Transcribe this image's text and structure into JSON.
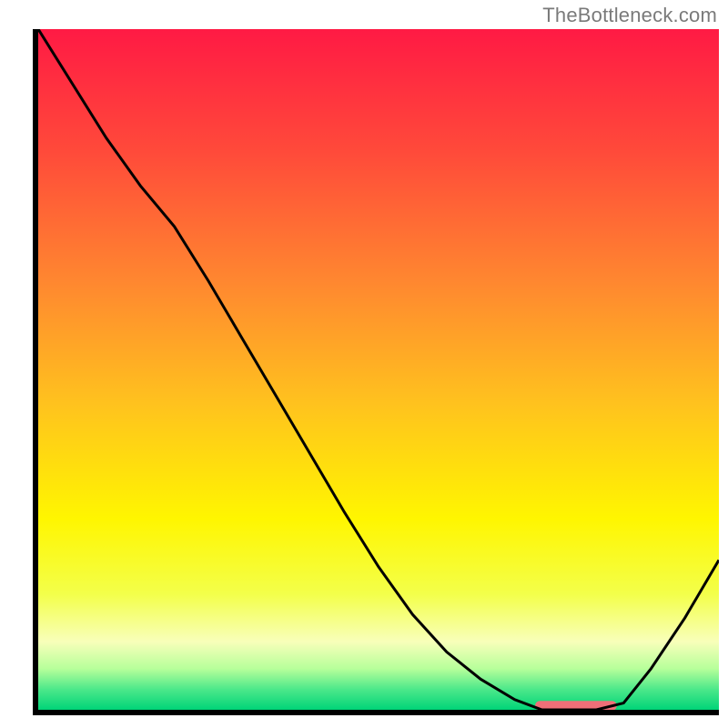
{
  "attribution": "TheBottleneck.com",
  "chart_data": {
    "type": "line",
    "x": [
      0.0,
      0.05,
      0.1,
      0.15,
      0.2,
      0.25,
      0.3,
      0.35,
      0.4,
      0.45,
      0.5,
      0.55,
      0.6,
      0.65,
      0.7,
      0.74,
      0.78,
      0.82,
      0.86,
      0.9,
      0.95,
      1.0
    ],
    "values": [
      1.0,
      0.92,
      0.84,
      0.77,
      0.71,
      0.63,
      0.545,
      0.46,
      0.375,
      0.29,
      0.21,
      0.14,
      0.085,
      0.045,
      0.015,
      0.0,
      0.0,
      0.0,
      0.01,
      0.06,
      0.135,
      0.22
    ],
    "xlabel": "",
    "ylabel": "",
    "title": "",
    "xlim": [
      0,
      1
    ],
    "ylim": [
      0,
      1
    ],
    "annotations": [
      {
        "type": "marker",
        "shape": "rounded-rect",
        "cx": 0.79,
        "cy": 0.006,
        "w": 0.12,
        "h": 0.014,
        "color": "#ef6f78"
      }
    ],
    "background": {
      "type": "vertical-gradient",
      "stops": [
        {
          "offset": 0.0,
          "color": "#ff1a44"
        },
        {
          "offset": 0.18,
          "color": "#ff4a3a"
        },
        {
          "offset": 0.38,
          "color": "#ff8a2f"
        },
        {
          "offset": 0.55,
          "color": "#ffc21e"
        },
        {
          "offset": 0.72,
          "color": "#fff600"
        },
        {
          "offset": 0.83,
          "color": "#f3ff4a"
        },
        {
          "offset": 0.9,
          "color": "#f8ffba"
        },
        {
          "offset": 0.94,
          "color": "#b6ff9a"
        },
        {
          "offset": 0.97,
          "color": "#4ce88a"
        },
        {
          "offset": 1.0,
          "color": "#00d478"
        }
      ]
    }
  }
}
